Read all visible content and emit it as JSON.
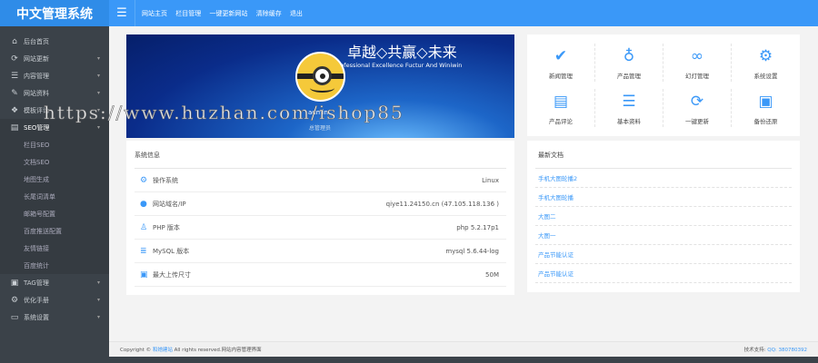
{
  "app_title": "中文管理系统",
  "topnav": [
    "网站主页",
    "栏目管理",
    "一键更新网站",
    "清除缓存",
    "退出"
  ],
  "sidebar": {
    "items": [
      {
        "label": "后台首页",
        "icon": "home-icon",
        "glyph": "⌂",
        "caret": false
      },
      {
        "label": "网站更新",
        "icon": "refresh-icon",
        "glyph": "⟳",
        "caret": true
      },
      {
        "label": "内容管理",
        "icon": "list-icon",
        "glyph": "☰",
        "caret": true
      },
      {
        "label": "网站资料",
        "icon": "plug-icon",
        "glyph": "✎",
        "caret": true
      },
      {
        "label": "模板评论",
        "icon": "cubes-icon",
        "glyph": "❖",
        "caret": true
      },
      {
        "label": "SEO管理",
        "icon": "file-icon",
        "glyph": "▤",
        "caret": true,
        "active": true
      }
    ],
    "sub_items": [
      "栏目SEO",
      "文档SEO",
      "地图生成",
      "长尾词清单",
      "邮箱号配置",
      "百度推送配置",
      "友情链接",
      "百度统计"
    ],
    "items_after": [
      {
        "label": "TAG管理",
        "icon": "archive-icon",
        "glyph": "▣",
        "caret": true
      },
      {
        "label": "优化手册",
        "icon": "cogs-icon",
        "glyph": "⚙",
        "caret": true
      },
      {
        "label": "系统设置",
        "icon": "desktop-icon",
        "glyph": "▭",
        "caret": true
      }
    ]
  },
  "banner": {
    "slogan_cn": "卓越◇共赢◇未来",
    "slogan_en": "Professional Excellence Fuctur And Winiwin",
    "username": "admin",
    "role": "总管理员"
  },
  "sysinfo": {
    "title": "系统信息",
    "rows": [
      {
        "key": "操作系统",
        "value": "Linux",
        "glyph": "⚙"
      },
      {
        "key": "网站域名/IP",
        "value": "qiye11.24150.cn (47.105.118.136 )",
        "glyph": "●"
      },
      {
        "key": "PHP 版本",
        "value": "php 5.2.17p1",
        "glyph": "♙"
      },
      {
        "key": "MySQL 版本",
        "value": "mysql 5.6.44-log",
        "glyph": "≣"
      },
      {
        "key": "最大上传尺寸",
        "value": "50M",
        "glyph": "▣"
      }
    ]
  },
  "quick": [
    {
      "label": "新闻管理",
      "glyph": "✔",
      "icon": "check-circle-icon"
    },
    {
      "label": "产品管理",
      "glyph": "♁",
      "icon": "lightbulb-icon"
    },
    {
      "label": "幻灯管理",
      "glyph": "∞",
      "icon": "link-icon"
    },
    {
      "label": "系统设置",
      "glyph": "⚙",
      "icon": "cogs-icon"
    },
    {
      "label": "产品评论",
      "glyph": "▤",
      "icon": "file-text-icon"
    },
    {
      "label": "基本资料",
      "glyph": "☰",
      "icon": "bars-icon"
    },
    {
      "label": "一键更新",
      "glyph": "⟳",
      "icon": "refresh-icon"
    },
    {
      "label": "备份还原",
      "glyph": "▣",
      "icon": "archive-icon"
    }
  ],
  "docs": {
    "title": "最新文档",
    "items": [
      "手机大图轮播2",
      "手机大图轮播",
      "大图二",
      "大图一",
      "产品节能认证",
      "产品节能认证"
    ]
  },
  "footer": {
    "copyright_pre": "Copyright © ",
    "company": "和她建站",
    "copyright_post": " All rights reserved.网站内容管理界面",
    "support_label": "技术支持: ",
    "qq": "QQ: 380780392"
  },
  "watermark": "https://www.huzhan.com/ishop85"
}
